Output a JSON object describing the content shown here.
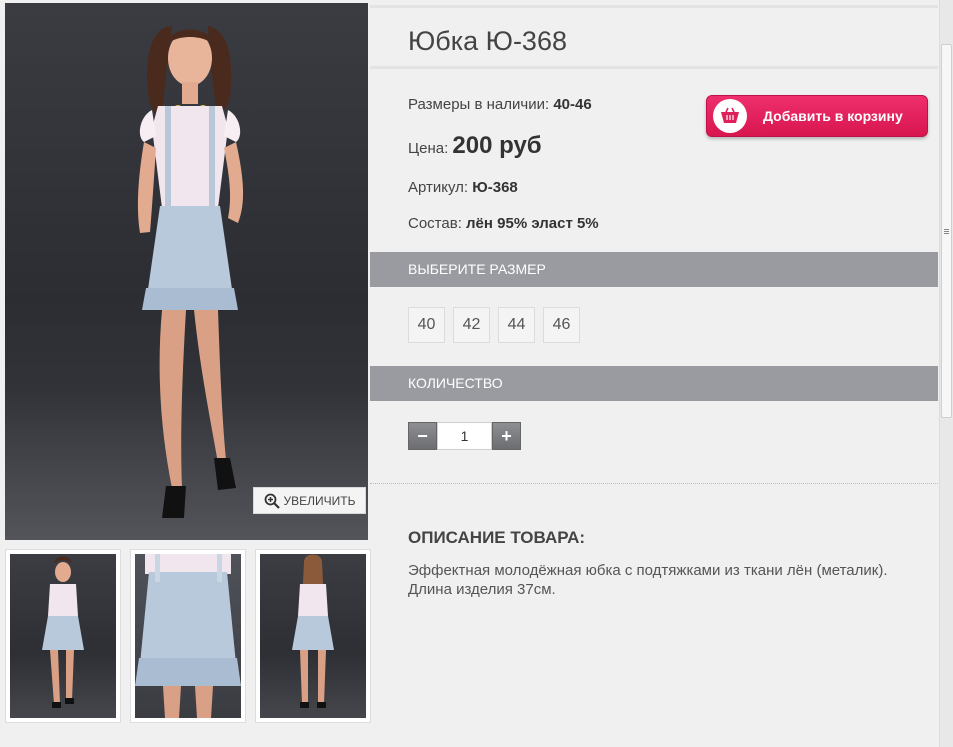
{
  "product": {
    "title": "Юбка Ю-368",
    "sizes_label": "Размеры в наличии:",
    "sizes_value": "40-46",
    "price_label": "Цена:",
    "price_value": "200 руб",
    "sku_label": "Артикул:",
    "sku_value": "Ю-368",
    "composition_label": "Состав:",
    "composition_value": "лён 95% эласт 5%"
  },
  "cart_button": {
    "label": "Добавить в корзину",
    "icon": "basket-icon",
    "color": "#e0205a"
  },
  "gallery": {
    "zoom_label": "УВЕЛИЧИТЬ",
    "zoom_icon": "magnifier-plus-icon",
    "thumbnails": [
      "front-view",
      "skirt-closeup",
      "back-view"
    ]
  },
  "size_section": {
    "heading": "ВЫБЕРИТЕ РАЗМЕР",
    "options": [
      "40",
      "42",
      "44",
      "46"
    ]
  },
  "quantity_section": {
    "heading": "КОЛИЧЕСТВО",
    "minus": "−",
    "plus": "+",
    "value": "1"
  },
  "description": {
    "heading": "ОПИСАНИЕ ТОВАРА:",
    "text": "Эффектная молодёжная юбка с подтяжками из ткани лён (металик). Длина изделия 37см."
  },
  "colors": {
    "section_bar": "#999ba0",
    "background": "#f0f0f0",
    "accent": "#e0205a"
  }
}
